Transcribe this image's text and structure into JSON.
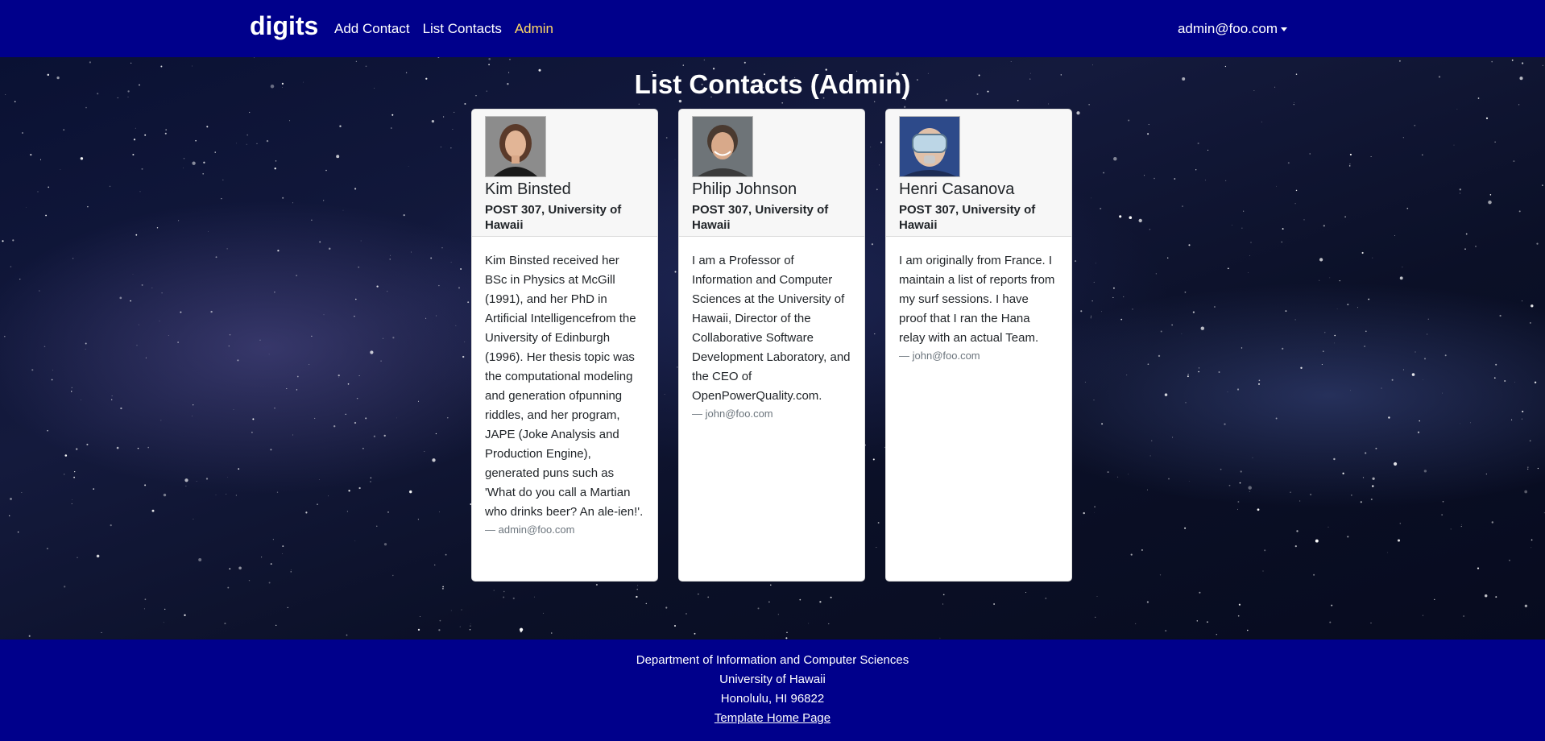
{
  "navbar": {
    "brand": "digits",
    "links": [
      {
        "label": "Add Contact"
      },
      {
        "label": "List Contacts"
      },
      {
        "label": "Admin"
      }
    ],
    "user": "admin@foo.com",
    "colors": {
      "background": "#00008b",
      "active_link": "#ffd966"
    }
  },
  "page": {
    "title": "List Contacts (Admin)"
  },
  "contacts": [
    {
      "name": "Kim Binsted",
      "address": "POST 307, University of Hawaii",
      "description": "Kim Binsted received her BSc in Physics at McGill (1991), and her PhD in Artificial Intelligencefrom the University of Edinburgh (1996). Her thesis topic was the computational modeling and generation ofpunning riddles, and her program, JAPE (Joke Analysis and Production Engine), generated puns such as 'What do you call a Martian who drinks beer? An ale-ien!'.",
      "owner": "— admin@foo.com",
      "avatar_icon": "woman-portrait-photo"
    },
    {
      "name": "Philip Johnson",
      "address": "POST 307, University of Hawaii",
      "description": "I am a Professor of Information and Computer Sciences at the University of Hawaii, Director of the Collaborative Software Development Laboratory, and the CEO of OpenPowerQuality.com.",
      "owner": "— john@foo.com",
      "avatar_icon": "man-portrait-photo"
    },
    {
      "name": "Henri Casanova",
      "address": "POST 307, University of Hawaii",
      "description": "I am originally from France. I maintain a list of reports from my surf sessions. I have proof that I ran the Hana relay with an actual Team.",
      "owner": "— john@foo.com",
      "avatar_icon": "man-with-goggles-photo"
    }
  ],
  "footer": {
    "line1": "Department of Information and Computer Sciences",
    "line2": "University of Hawaii",
    "line3": "Honolulu, HI 96822",
    "link": "Template Home Page"
  }
}
